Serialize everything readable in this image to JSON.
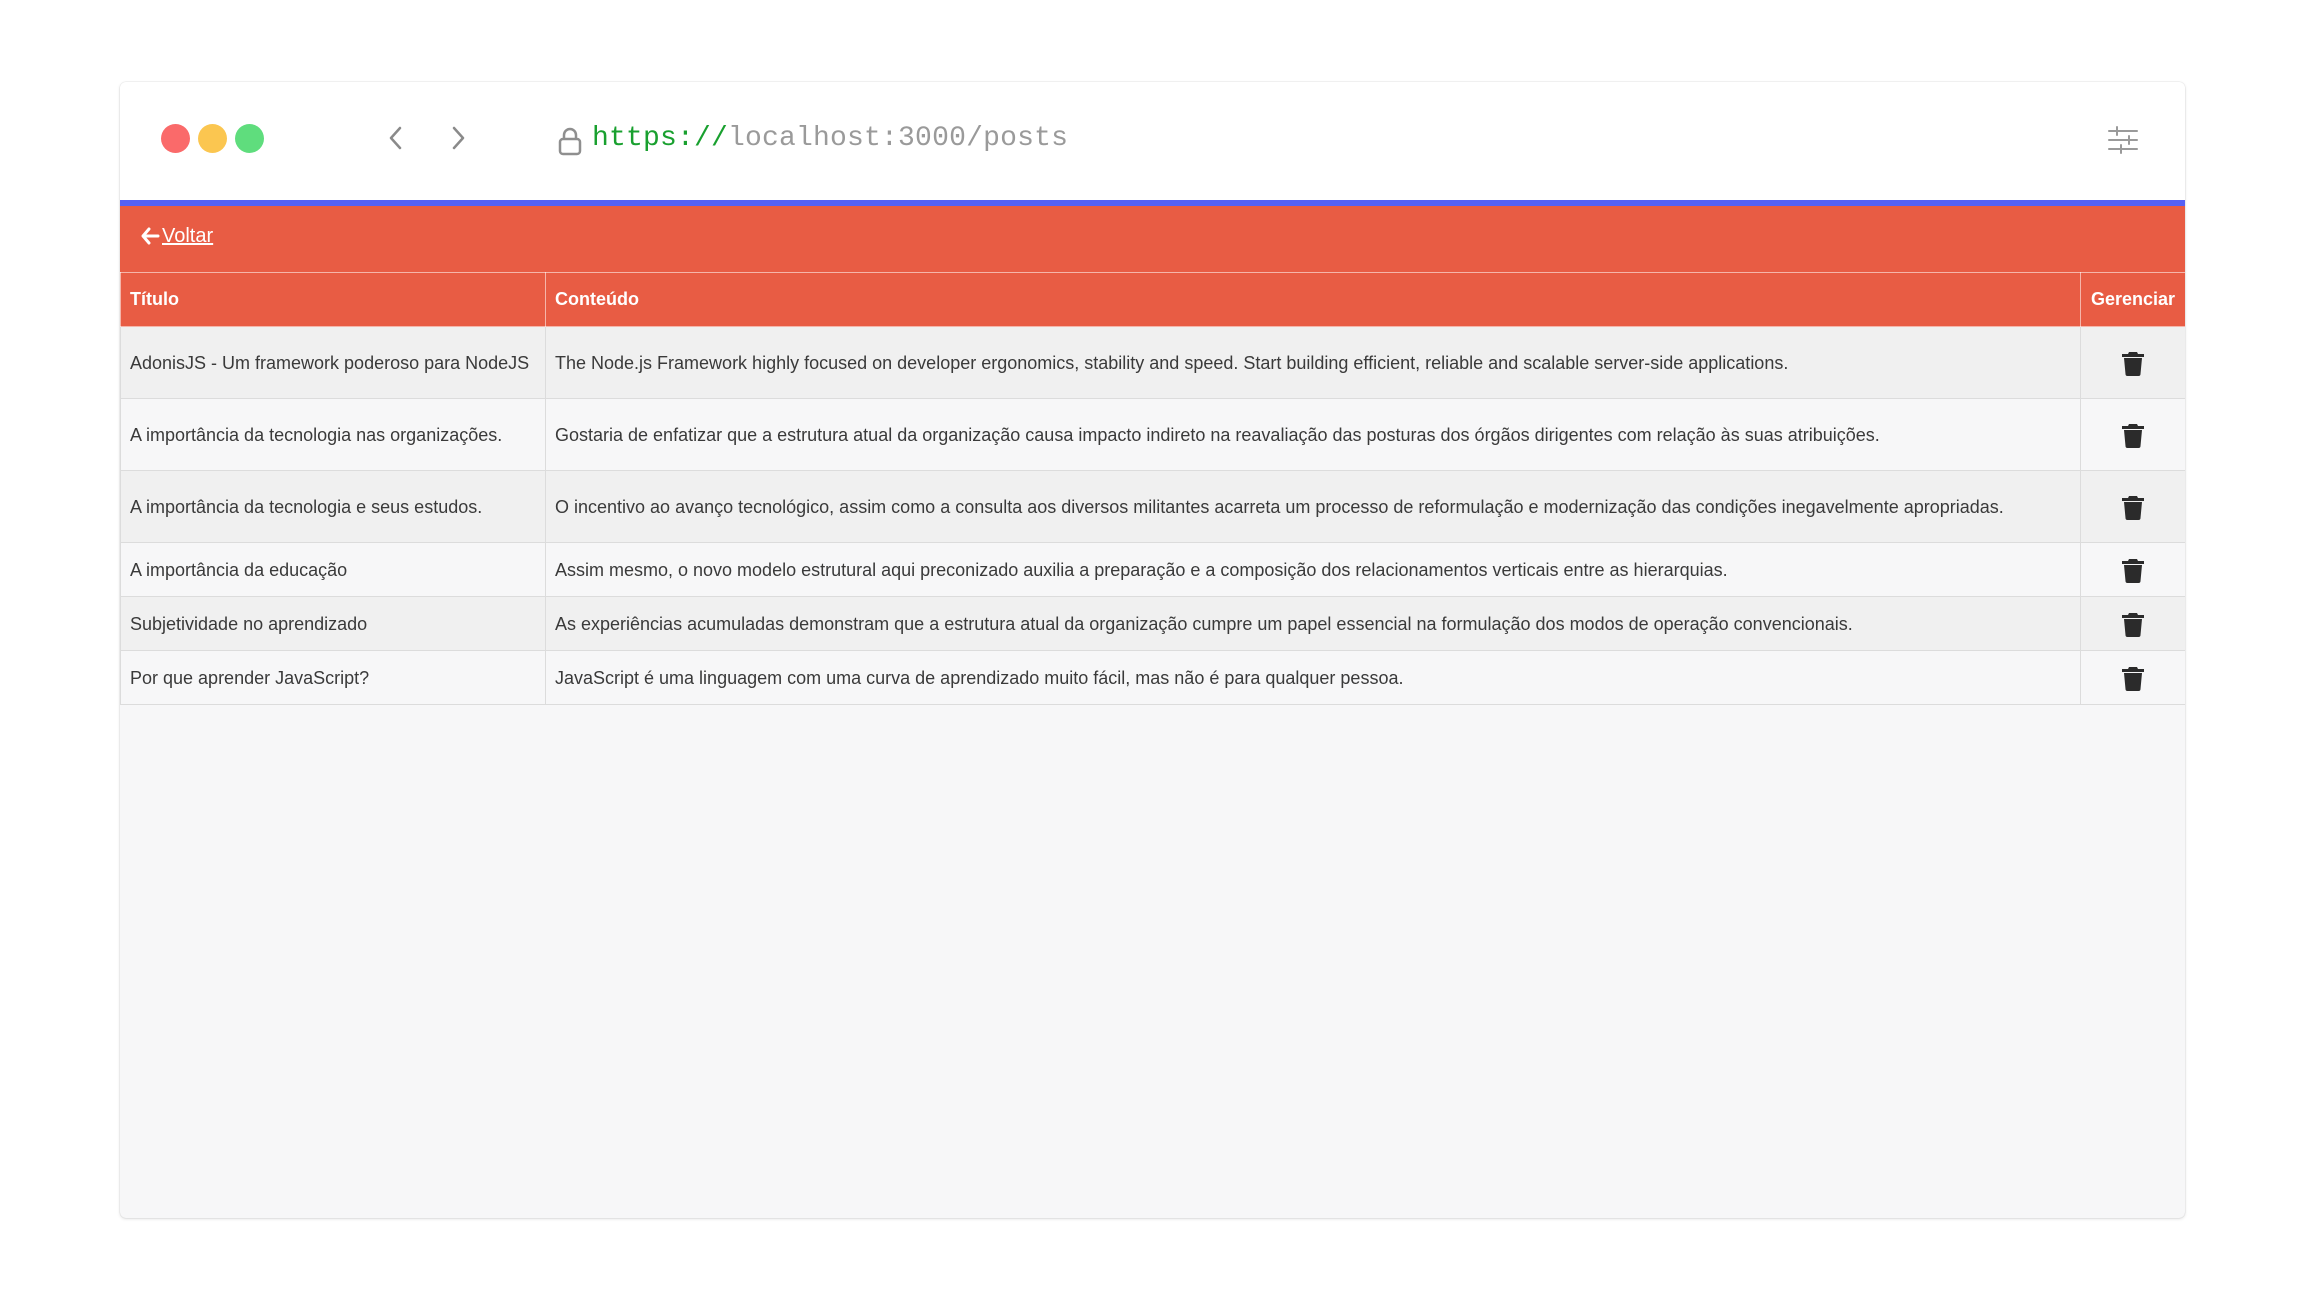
{
  "browser": {
    "url_scheme": "https://",
    "url_rest": "localhost:3000/posts",
    "traffic_lights": [
      "#fa6a6a",
      "#fbc650",
      "#5fdd7d"
    ]
  },
  "colors": {
    "accent": "#e85c44",
    "progress": "#5561f5"
  },
  "app": {
    "back_label": "Voltar"
  },
  "table": {
    "columns": [
      "Título",
      "Conteúdo",
      "Gerenciar"
    ],
    "rows": [
      {
        "title": "AdonisJS - Um framework poderoso para NodeJS",
        "content": "The Node.js Framework highly focused on developer ergonomics, stability and speed. Start building efficient, reliable and scalable server-side applications."
      },
      {
        "title": "A importância da tecnologia nas organizações.",
        "content": "Gostaria de enfatizar que a estrutura atual da organização causa impacto indireto na reavaliação das posturas dos órgãos dirigentes com relação às suas atribuições."
      },
      {
        "title": "A importância da tecnologia e seus estudos.",
        "content": "O incentivo ao avanço tecnológico, assim como a consulta aos diversos militantes acarreta um processo de reformulação e modernização das condições inegavelmente apropriadas."
      },
      {
        "title": "A importância da educação",
        "content": "Assim mesmo, o novo modelo estrutural aqui preconizado auxilia a preparação e a composição dos relacionamentos verticais entre as hierarquias."
      },
      {
        "title": "Subjetividade no aprendizado",
        "content": "As experiências acumuladas demonstram que a estrutura atual da organização cumpre um papel essencial na formulação dos modos de operação convencionais."
      },
      {
        "title": "Por que aprender JavaScript?",
        "content": "JavaScript é uma linguagem com uma curva de aprendizado muito fácil, mas não é para qualquer pessoa."
      }
    ]
  }
}
